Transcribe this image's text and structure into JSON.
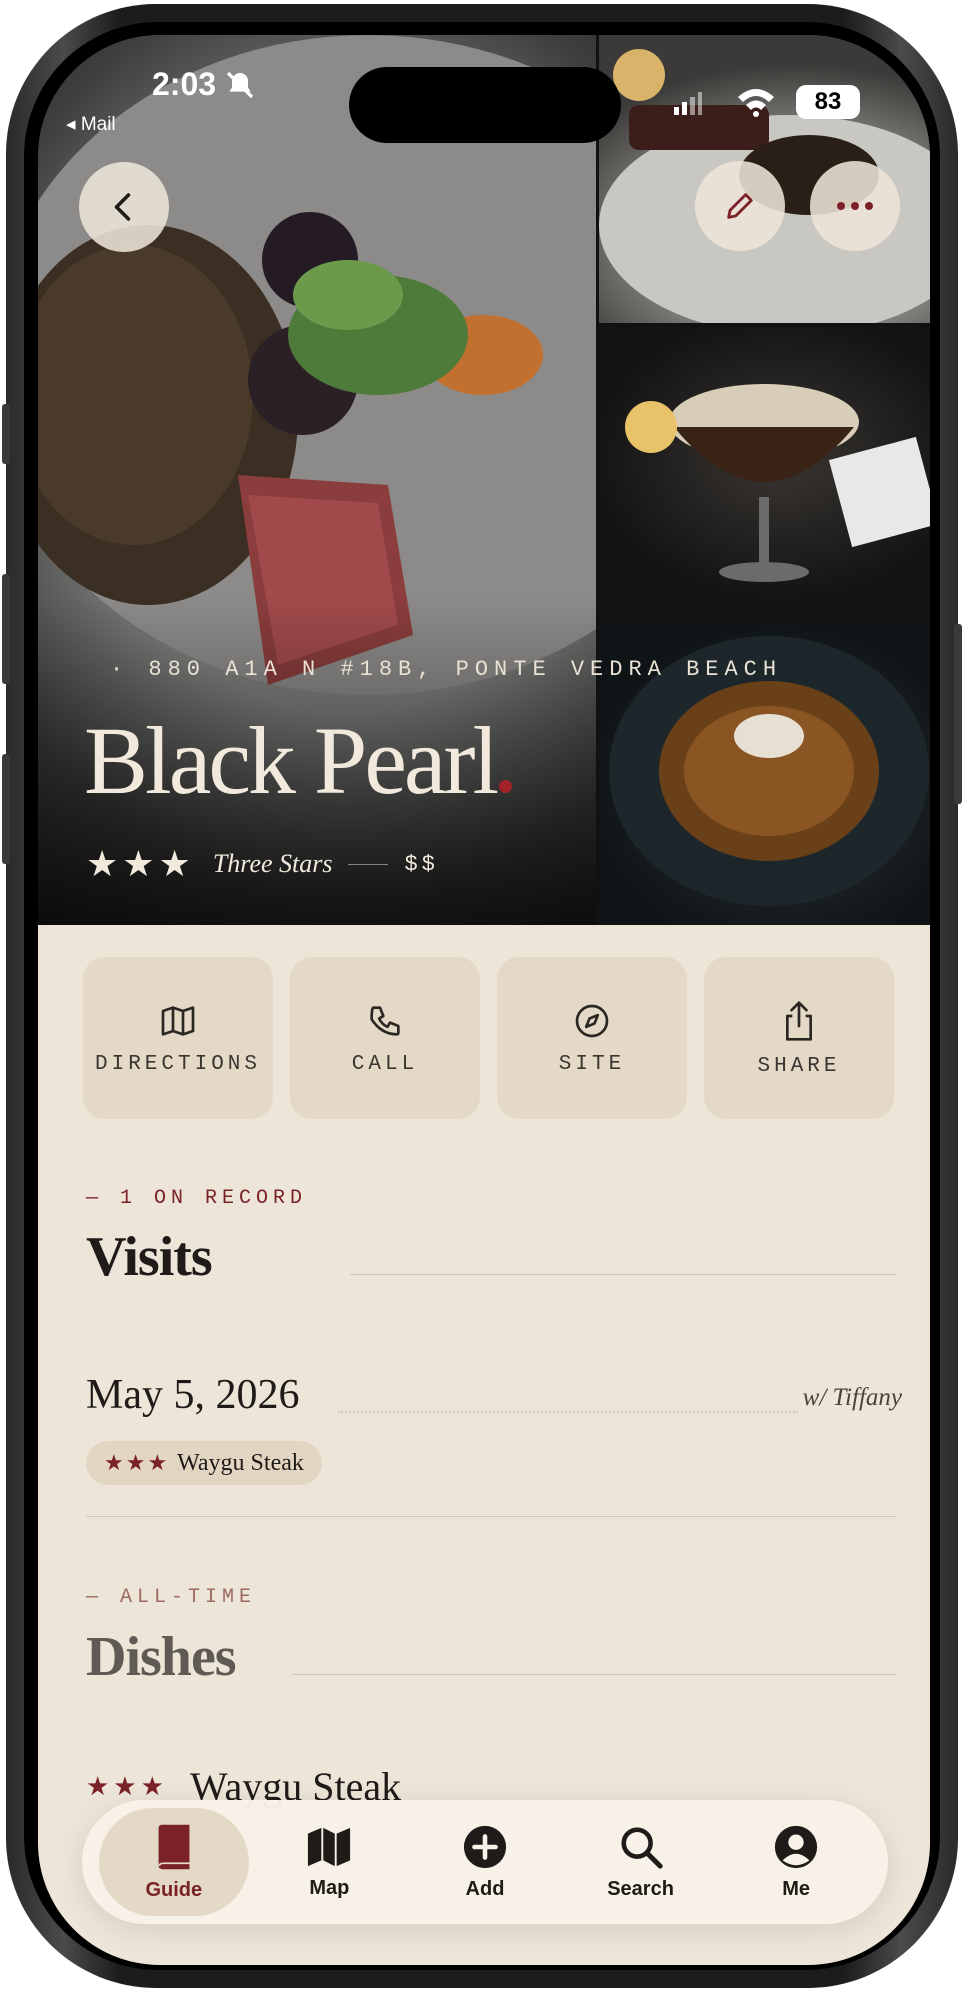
{
  "status_bar": {
    "time": "2:03",
    "back_label": "◂ Mail",
    "battery": "83"
  },
  "restaurant": {
    "address": "· 880 A1A N #18B, PONTE VEDRA BEACH",
    "name": "Black Pearl",
    "stars": "★★★",
    "rating_text": "Three Stars",
    "price": "$$"
  },
  "actions": [
    {
      "label": "DIRECTIONS",
      "icon": "map-icon"
    },
    {
      "label": "CALL",
      "icon": "phone-icon"
    },
    {
      "label": "SITE",
      "icon": "compass-icon"
    },
    {
      "label": "SHARE",
      "icon": "share-icon"
    }
  ],
  "visits": {
    "kicker": "— 1 ON RECORD",
    "title": "Visits",
    "items": [
      {
        "date": "May 5, 2026",
        "with": "w/ Tiffany",
        "chip_stars": "★★★",
        "chip_dish": "Waygu Steak"
      }
    ]
  },
  "dishes": {
    "kicker": "— ALL-TIME",
    "title": "Dishes",
    "items": [
      {
        "stars": "★★★",
        "name": "Waygu Steak"
      }
    ]
  },
  "tabbar": {
    "items": [
      {
        "label": "Guide",
        "icon": "book-icon",
        "active": true
      },
      {
        "label": "Map",
        "icon": "map-icon",
        "active": false
      },
      {
        "label": "Add",
        "icon": "plus-circle-icon",
        "active": false
      },
      {
        "label": "Search",
        "icon": "search-icon",
        "active": false
      },
      {
        "label": "Me",
        "icon": "person-icon",
        "active": false
      }
    ]
  },
  "colors": {
    "accent": "#7b2128",
    "background": "#ede5d7",
    "card": "#e4d9c6"
  }
}
